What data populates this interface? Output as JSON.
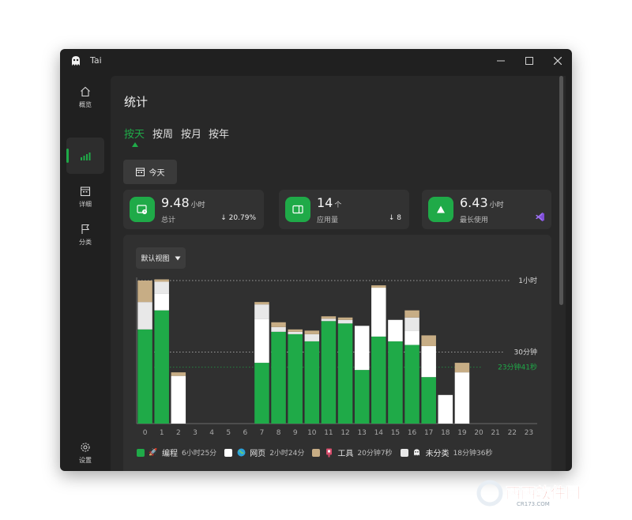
{
  "app": {
    "title": "Tai"
  },
  "sidebar": {
    "items": [
      {
        "label": "概览",
        "icon": "home-icon"
      },
      {
        "label": "",
        "icon": "stats-icon"
      },
      {
        "label": "详细",
        "icon": "calendar-icon"
      },
      {
        "label": "分类",
        "icon": "flag-icon"
      },
      {
        "label": "设置",
        "icon": "gear-icon"
      }
    ]
  },
  "page": {
    "title": "统计"
  },
  "tabs": [
    {
      "label": "按天",
      "active": true
    },
    {
      "label": "按周",
      "active": false
    },
    {
      "label": "按月",
      "active": false
    },
    {
      "label": "按年",
      "active": false
    }
  ],
  "date_button": {
    "label": "今天"
  },
  "cards": [
    {
      "value": "9.48",
      "unit": "小时",
      "label": "总计",
      "change": "↓ 20.79%"
    },
    {
      "value": "14",
      "unit": "个",
      "label": "应用量",
      "change": "↓ 8"
    },
    {
      "value": "6.43",
      "unit": "小时",
      "label": "最长使用",
      "change": ""
    }
  ],
  "view_select": {
    "value": "默认视图"
  },
  "chart_data": {
    "type": "bar",
    "stacked": true,
    "categories": [
      "0",
      "1",
      "2",
      "3",
      "4",
      "5",
      "6",
      "7",
      "8",
      "9",
      "10",
      "11",
      "12",
      "13",
      "14",
      "15",
      "16",
      "17",
      "18",
      "19",
      "20",
      "21",
      "22",
      "23"
    ],
    "ylim_minutes": [
      0,
      60
    ],
    "reference_lines": [
      {
        "label": "1小时",
        "minutes": 60
      },
      {
        "label": "30分钟",
        "minutes": 30
      },
      {
        "label": "23分钟41秒",
        "minutes": 23.68,
        "color": "#1faa48"
      }
    ],
    "series": [
      {
        "name": "编程",
        "color": "#1faa48",
        "values": [
          39.5,
          47.5,
          0,
          0,
          0,
          0,
          0,
          25.5,
          38.5,
          37.5,
          34.5,
          43,
          42,
          22.5,
          36.5,
          34.5,
          33,
          19.5,
          0,
          0,
          0,
          0,
          0,
          0
        ]
      },
      {
        "name": "网页",
        "color": "#ffffff",
        "values": [
          0,
          7,
          20,
          0,
          0,
          0,
          0,
          18.5,
          0,
          0,
          0,
          0,
          0,
          18.5,
          20.5,
          9,
          6,
          13,
          12,
          21.5,
          0,
          0,
          0,
          0
        ]
      },
      {
        "name": "未分类",
        "color": "#e8e8e8",
        "values": [
          11.5,
          5,
          0,
          0,
          0,
          0,
          0,
          6,
          2,
          1,
          3,
          1,
          1.5,
          0,
          0,
          0,
          5.5,
          0,
          0,
          0,
          0,
          0,
          0,
          0
        ]
      },
      {
        "name": "工具",
        "color": "#c7ad85",
        "values": [
          9,
          1,
          1.5,
          0,
          0,
          0,
          0,
          1,
          2,
          1,
          1.5,
          1,
          1,
          0,
          1,
          0,
          3,
          4.5,
          0,
          4,
          0,
          0,
          0,
          0
        ]
      }
    ]
  },
  "legend": [
    {
      "name": "编程",
      "time": "6小时25分",
      "color": "#1faa48",
      "icon": "rocket-icon"
    },
    {
      "name": "网页",
      "time": "2小时24分",
      "color": "#ffffff",
      "icon": "globe-icon"
    },
    {
      "name": "工具",
      "time": "20分钟7秒",
      "color": "#c7ad85",
      "icon": "tool-icon"
    },
    {
      "name": "未分类",
      "time": "18分钟36秒",
      "color": "#e8e8e8",
      "icon": "ghost-icon"
    }
  ],
  "watermark": {
    "text": "西西软件园",
    "sub": "CR173.COM"
  }
}
